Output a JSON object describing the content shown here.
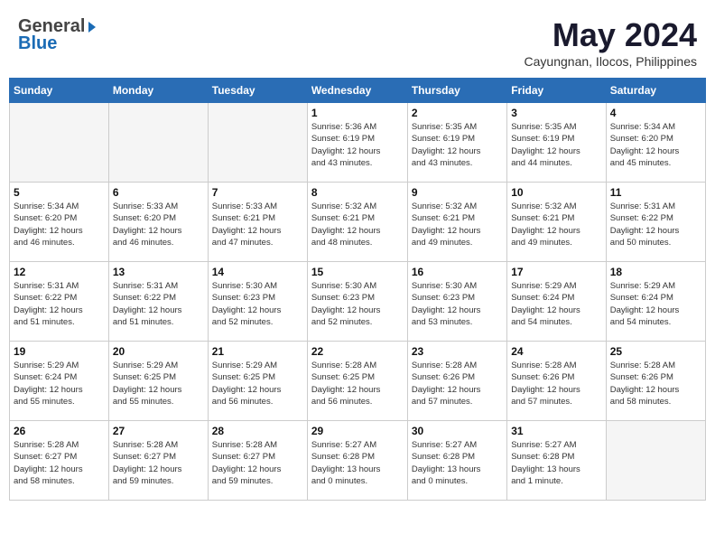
{
  "header": {
    "logo_general": "General",
    "logo_blue": "Blue",
    "month": "May 2024",
    "location": "Cayungnan, Ilocos, Philippines"
  },
  "weekdays": [
    "Sunday",
    "Monday",
    "Tuesday",
    "Wednesday",
    "Thursday",
    "Friday",
    "Saturday"
  ],
  "weeks": [
    [
      {
        "day": "",
        "info": ""
      },
      {
        "day": "",
        "info": ""
      },
      {
        "day": "",
        "info": ""
      },
      {
        "day": "1",
        "info": "Sunrise: 5:36 AM\nSunset: 6:19 PM\nDaylight: 12 hours\nand 43 minutes."
      },
      {
        "day": "2",
        "info": "Sunrise: 5:35 AM\nSunset: 6:19 PM\nDaylight: 12 hours\nand 43 minutes."
      },
      {
        "day": "3",
        "info": "Sunrise: 5:35 AM\nSunset: 6:19 PM\nDaylight: 12 hours\nand 44 minutes."
      },
      {
        "day": "4",
        "info": "Sunrise: 5:34 AM\nSunset: 6:20 PM\nDaylight: 12 hours\nand 45 minutes."
      }
    ],
    [
      {
        "day": "5",
        "info": "Sunrise: 5:34 AM\nSunset: 6:20 PM\nDaylight: 12 hours\nand 46 minutes."
      },
      {
        "day": "6",
        "info": "Sunrise: 5:33 AM\nSunset: 6:20 PM\nDaylight: 12 hours\nand 46 minutes."
      },
      {
        "day": "7",
        "info": "Sunrise: 5:33 AM\nSunset: 6:21 PM\nDaylight: 12 hours\nand 47 minutes."
      },
      {
        "day": "8",
        "info": "Sunrise: 5:32 AM\nSunset: 6:21 PM\nDaylight: 12 hours\nand 48 minutes."
      },
      {
        "day": "9",
        "info": "Sunrise: 5:32 AM\nSunset: 6:21 PM\nDaylight: 12 hours\nand 49 minutes."
      },
      {
        "day": "10",
        "info": "Sunrise: 5:32 AM\nSunset: 6:21 PM\nDaylight: 12 hours\nand 49 minutes."
      },
      {
        "day": "11",
        "info": "Sunrise: 5:31 AM\nSunset: 6:22 PM\nDaylight: 12 hours\nand 50 minutes."
      }
    ],
    [
      {
        "day": "12",
        "info": "Sunrise: 5:31 AM\nSunset: 6:22 PM\nDaylight: 12 hours\nand 51 minutes."
      },
      {
        "day": "13",
        "info": "Sunrise: 5:31 AM\nSunset: 6:22 PM\nDaylight: 12 hours\nand 51 minutes."
      },
      {
        "day": "14",
        "info": "Sunrise: 5:30 AM\nSunset: 6:23 PM\nDaylight: 12 hours\nand 52 minutes."
      },
      {
        "day": "15",
        "info": "Sunrise: 5:30 AM\nSunset: 6:23 PM\nDaylight: 12 hours\nand 52 minutes."
      },
      {
        "day": "16",
        "info": "Sunrise: 5:30 AM\nSunset: 6:23 PM\nDaylight: 12 hours\nand 53 minutes."
      },
      {
        "day": "17",
        "info": "Sunrise: 5:29 AM\nSunset: 6:24 PM\nDaylight: 12 hours\nand 54 minutes."
      },
      {
        "day": "18",
        "info": "Sunrise: 5:29 AM\nSunset: 6:24 PM\nDaylight: 12 hours\nand 54 minutes."
      }
    ],
    [
      {
        "day": "19",
        "info": "Sunrise: 5:29 AM\nSunset: 6:24 PM\nDaylight: 12 hours\nand 55 minutes."
      },
      {
        "day": "20",
        "info": "Sunrise: 5:29 AM\nSunset: 6:25 PM\nDaylight: 12 hours\nand 55 minutes."
      },
      {
        "day": "21",
        "info": "Sunrise: 5:29 AM\nSunset: 6:25 PM\nDaylight: 12 hours\nand 56 minutes."
      },
      {
        "day": "22",
        "info": "Sunrise: 5:28 AM\nSunset: 6:25 PM\nDaylight: 12 hours\nand 56 minutes."
      },
      {
        "day": "23",
        "info": "Sunrise: 5:28 AM\nSunset: 6:26 PM\nDaylight: 12 hours\nand 57 minutes."
      },
      {
        "day": "24",
        "info": "Sunrise: 5:28 AM\nSunset: 6:26 PM\nDaylight: 12 hours\nand 57 minutes."
      },
      {
        "day": "25",
        "info": "Sunrise: 5:28 AM\nSunset: 6:26 PM\nDaylight: 12 hours\nand 58 minutes."
      }
    ],
    [
      {
        "day": "26",
        "info": "Sunrise: 5:28 AM\nSunset: 6:27 PM\nDaylight: 12 hours\nand 58 minutes."
      },
      {
        "day": "27",
        "info": "Sunrise: 5:28 AM\nSunset: 6:27 PM\nDaylight: 12 hours\nand 59 minutes."
      },
      {
        "day": "28",
        "info": "Sunrise: 5:28 AM\nSunset: 6:27 PM\nDaylight: 12 hours\nand 59 minutes."
      },
      {
        "day": "29",
        "info": "Sunrise: 5:27 AM\nSunset: 6:28 PM\nDaylight: 13 hours\nand 0 minutes."
      },
      {
        "day": "30",
        "info": "Sunrise: 5:27 AM\nSunset: 6:28 PM\nDaylight: 13 hours\nand 0 minutes."
      },
      {
        "day": "31",
        "info": "Sunrise: 5:27 AM\nSunset: 6:28 PM\nDaylight: 13 hours\nand 1 minute."
      },
      {
        "day": "",
        "info": ""
      }
    ]
  ]
}
